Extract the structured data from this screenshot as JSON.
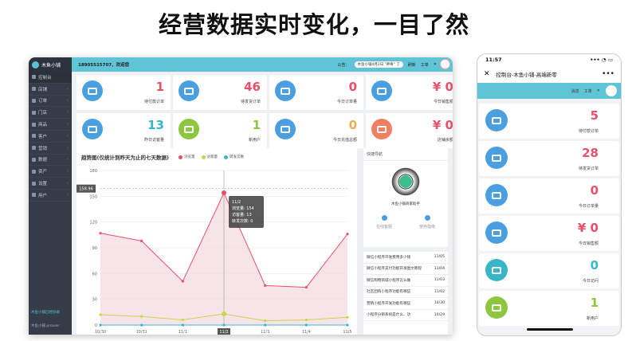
{
  "headline": "经营数据实时变化，一目了然",
  "desktop": {
    "logo": "木鱼小铺",
    "phone": "18905515707、欢迎您",
    "notice_label": "公告：",
    "notice_text": "木鱼小铺4月2日 \"神奇\" 了",
    "refresh": "刷新",
    "work": "工单",
    "sidebar": [
      {
        "label": "控制台"
      },
      {
        "label": "店铺"
      },
      {
        "label": "订单"
      },
      {
        "label": "门店"
      },
      {
        "label": "商品"
      },
      {
        "label": "客户"
      },
      {
        "label": "营销"
      },
      {
        "label": "数据"
      },
      {
        "label": "资产"
      },
      {
        "label": "设置"
      },
      {
        "label": "用户"
      }
    ],
    "side_foot": "木鱼小铺已经协助",
    "side_user": "木鱼小铺 pnauer",
    "cards": [
      {
        "value": "1",
        "label": "待付款订单",
        "color": "#e8506a",
        "icon": "wallet-icon"
      },
      {
        "value": "46",
        "label": "待发货订单",
        "color": "#e8506a",
        "icon": "truck-icon"
      },
      {
        "value": "0",
        "label": "今日订单量",
        "color": "#e8506a",
        "icon": "leaf-icon"
      },
      {
        "value": "¥ 0",
        "label": "今日销售额",
        "color": "#e8506a",
        "icon": "cash-icon"
      },
      {
        "value": "13",
        "label": "昨日访客量",
        "color": "#38b6c9",
        "icon": "pulse-icon"
      },
      {
        "value": "1",
        "label": "新用户",
        "color": "#8dc63f",
        "icon": "user-icon"
      },
      {
        "value": "0",
        "label": "今日充值总额",
        "color": "#f0ad4e",
        "icon": "cash-icon"
      },
      {
        "value": "¥ 0",
        "label": "店铺余额",
        "color": "#e8506a",
        "icon": "shop-icon"
      }
    ],
    "chart_title": "趋势图(仅统计到昨天为止的七天数据)",
    "tooltip": {
      "date": "11/2",
      "browse": "浏览量: 154",
      "visits": "访客量: 13",
      "conv": "转发次数: 0"
    },
    "qr_header": "快捷导航",
    "qr_caption": "木鱼小铺商家助手",
    "help": [
      {
        "label": "在线客服"
      },
      {
        "label": "使用指南"
      }
    ],
    "news": [
      {
        "title": "微信小程序开发费用多少钱",
        "date": "11/05"
      },
      {
        "title": "微信小程序支付功能开发图文教程",
        "date": "11/04"
      },
      {
        "title": "微信购物商城小程序怎么做",
        "date": "11/03"
      },
      {
        "title": "社区团购小程序功能有哪些",
        "date": "11/02"
      },
      {
        "title": "营销小程序开发功能有哪些",
        "date": "10/30"
      },
      {
        "title": "小程序分销系统是什么、功",
        "date": "10/29"
      }
    ]
  },
  "mobile": {
    "time": "11:57",
    "signal": "••• ◔ ▭",
    "title": "控制台-木鱼小铺-高端新零",
    "more": "•••",
    "bar_links": [
      "消息",
      "工单"
    ],
    "cards": [
      {
        "value": "5",
        "label": "待付款订单",
        "color": "#e8506a",
        "icon": "wallet-icon",
        "circle": "#4a9fe0"
      },
      {
        "value": "28",
        "label": "待发货订单",
        "color": "#e8506a",
        "icon": "truck-icon",
        "circle": "#4a9fe0"
      },
      {
        "value": "0",
        "label": "今日订单量",
        "color": "#e8506a",
        "icon": "leaf-icon",
        "circle": "#4a9fe0"
      },
      {
        "value": "¥ 0",
        "label": "今日销售额",
        "color": "#e8506a",
        "icon": "cash-icon",
        "circle": "#4a9fe0"
      },
      {
        "value": "0",
        "label": "今日访问",
        "color": "#38b6c9",
        "icon": "pulse-icon",
        "circle": "#38b6c9"
      },
      {
        "value": "1",
        "label": "新用户",
        "color": "#8dc63f",
        "icon": "user-icon",
        "circle": "#8dc63f"
      }
    ]
  },
  "chart_data": {
    "type": "line",
    "title": "趋势图(仅统计到昨天为止的七天数据)",
    "categories": [
      "10/30",
      "10/31",
      "11/1",
      "11/2",
      "11/3",
      "11/4",
      "11/5"
    ],
    "series": [
      {
        "name": "浏览量",
        "values": [
          107,
          98,
          51,
          154,
          46,
          44,
          106
        ],
        "color": "#e8506a"
      },
      {
        "name": "访客量",
        "values": [
          12,
          10,
          6,
          13,
          5,
          6,
          9
        ],
        "color": "#c9d64a"
      },
      {
        "name": "转发次数",
        "values": [
          0,
          0,
          0,
          0,
          0,
          0,
          0
        ],
        "color": "#38b6c9"
      }
    ],
    "yticks": [
      0,
      30,
      60,
      90,
      120,
      150,
      180
    ],
    "ylim": [
      0,
      180
    ],
    "highlight_value": "158.96",
    "grid": true
  }
}
